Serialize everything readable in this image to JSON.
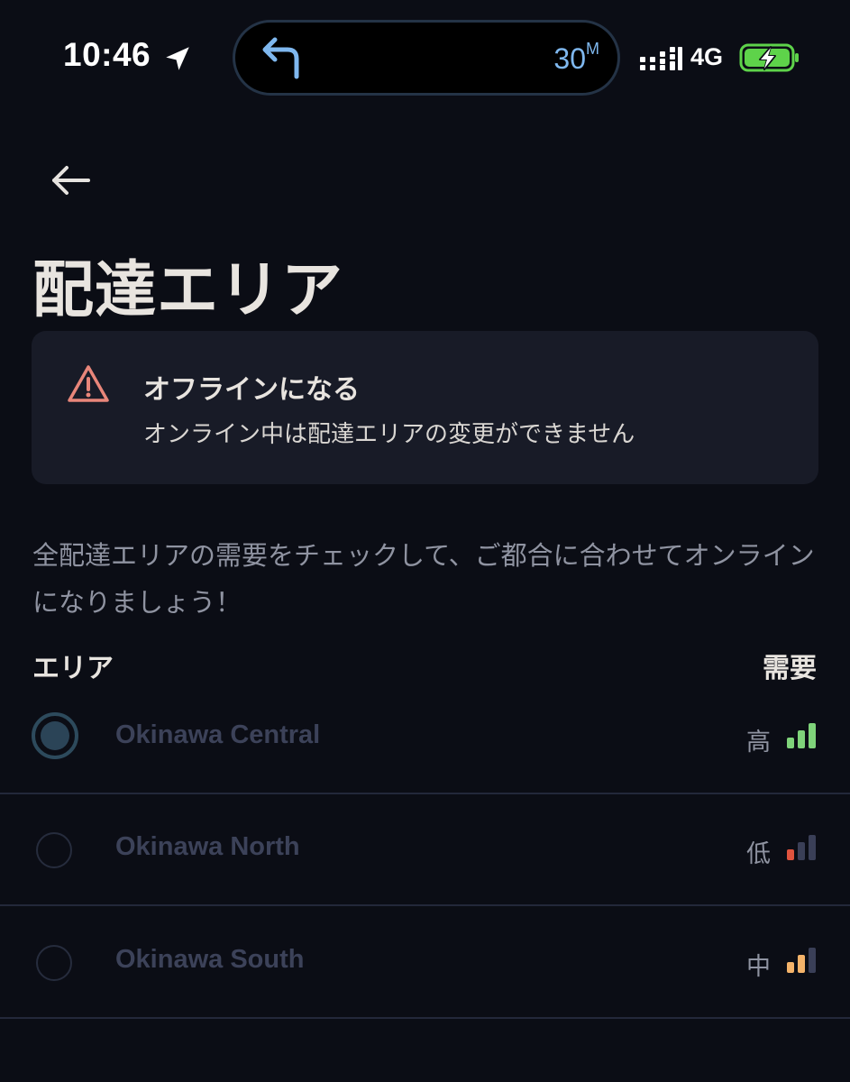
{
  "status_bar": {
    "time": "10:46",
    "eta_value": "30",
    "eta_unit": "M",
    "network": "4G",
    "icons": [
      "location-arrow-icon",
      "turn-left-icon",
      "cellular-signal-icon",
      "battery-charging-icon"
    ]
  },
  "nav": {
    "back_icon": "arrow-left-icon"
  },
  "page": {
    "title": "配達エリア"
  },
  "warning": {
    "icon": "warning-triangle-icon",
    "title": "オフラインになる",
    "message": "オンライン中は配達エリアの変更ができません"
  },
  "description": "全配達エリアの需要をチェックして、ご都合に合わせてオンラインになりましょう！",
  "columns": {
    "area": "エリア",
    "demand": "需要"
  },
  "areas": [
    {
      "name": "Okinawa Central",
      "demand": "高",
      "selected": true,
      "level": 3,
      "color": "#7fd37a"
    },
    {
      "name": "Okinawa North",
      "demand": "低",
      "selected": false,
      "level": 1,
      "color": "#e0533e"
    },
    {
      "name": "Okinawa South",
      "demand": "中",
      "selected": false,
      "level": 2,
      "color": "#f4b36a"
    }
  ],
  "colors": {
    "background": "#0b0d15",
    "card": "#181b27",
    "accent_eta": "#7fb8ef",
    "warning": "#e8867a",
    "bar_inactive": "#3a3f57",
    "battery_green": "#5ed34a"
  }
}
